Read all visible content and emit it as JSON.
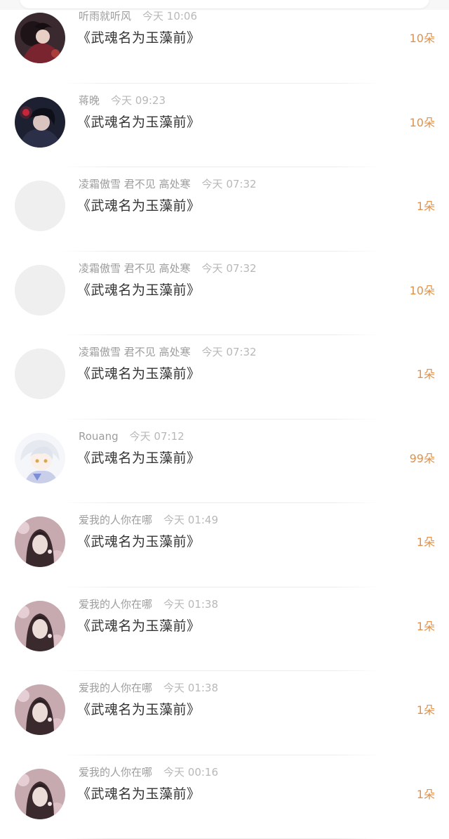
{
  "rows": [
    {
      "user": "听雨就听风",
      "time": "今天 10:06",
      "title": "《武魂名为玉藻前》",
      "flowers": "10朵",
      "avatar": "dark-red-girl-avatar"
    },
    {
      "user": "蒋晚",
      "time": "今天 09:23",
      "title": "《武魂名为玉藻前》",
      "flowers": "10朵",
      "avatar": "dark-boy-avatar"
    },
    {
      "user": "凌霜傲雪 君不见 高处寒",
      "time": "今天 07:32",
      "title": "《武魂名为玉藻前》",
      "flowers": "1朵",
      "avatar": "blank-avatar"
    },
    {
      "user": "凌霜傲雪 君不见 高处寒",
      "time": "今天 07:32",
      "title": "《武魂名为玉藻前》",
      "flowers": "10朵",
      "avatar": "blank-avatar"
    },
    {
      "user": "凌霜傲雪 君不见 高处寒",
      "time": "今天 07:32",
      "title": "《武魂名为玉藻前》",
      "flowers": "1朵",
      "avatar": "blank-avatar"
    },
    {
      "user": "Rouang",
      "time": "今天 07:12",
      "title": "《武魂名为玉藻前》",
      "flowers": "99朵",
      "avatar": "white-hair-chibi-avatar"
    },
    {
      "user": "爱我的人你在哪",
      "time": "今天 01:49",
      "title": "《武魂名为玉藻前》",
      "flowers": "1朵",
      "avatar": "floral-girl-avatar"
    },
    {
      "user": "爱我的人你在哪",
      "time": "今天 01:38",
      "title": "《武魂名为玉藻前》",
      "flowers": "1朵",
      "avatar": "floral-girl-avatar"
    },
    {
      "user": "爱我的人你在哪",
      "time": "今天 01:38",
      "title": "《武魂名为玉藻前》",
      "flowers": "1朵",
      "avatar": "floral-girl-avatar"
    },
    {
      "user": "爱我的人你在哪",
      "time": "今天 00:16",
      "title": "《武魂名为玉藻前》",
      "flowers": "1朵",
      "avatar": "floral-girl-avatar"
    }
  ],
  "colors": {
    "flowers": "#e0914a",
    "username": "#9d9d9d",
    "time": "#b8b8b8",
    "title": "#333333",
    "placeholder_avatar": "#efefef"
  }
}
